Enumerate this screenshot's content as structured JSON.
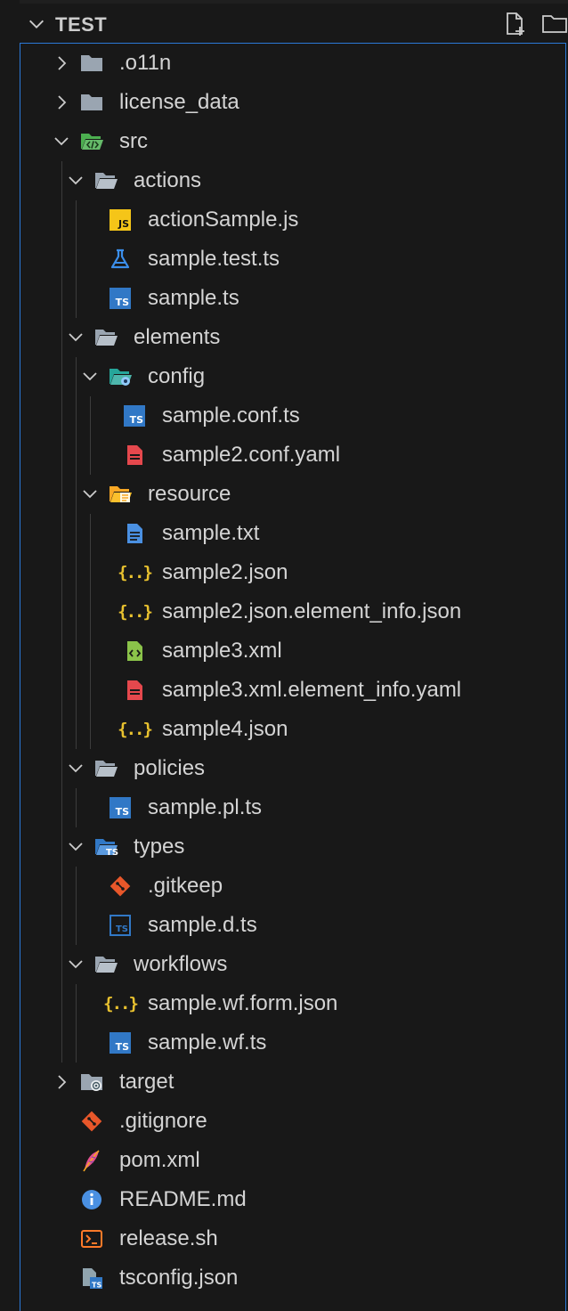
{
  "explorer": {
    "section_title": "TEST",
    "actions": [
      {
        "name": "new-file-icon"
      },
      {
        "name": "new-folder-icon"
      }
    ]
  },
  "tree": [
    {
      "label": ".o11n",
      "depth": 0,
      "kind": "folder",
      "state": "collapsed",
      "icon": "folder-icon"
    },
    {
      "label": "license_data",
      "depth": 0,
      "kind": "folder",
      "state": "collapsed",
      "icon": "folder-icon"
    },
    {
      "label": "src",
      "depth": 0,
      "kind": "folder",
      "state": "expanded",
      "icon": "folder-src-icon"
    },
    {
      "label": "actions",
      "depth": 1,
      "kind": "folder",
      "state": "expanded",
      "icon": "folder-open-icon"
    },
    {
      "label": "actionSample.js",
      "depth": 2,
      "kind": "file",
      "icon": "javascript-icon"
    },
    {
      "label": "sample.test.ts",
      "depth": 2,
      "kind": "file",
      "icon": "test-flask-icon"
    },
    {
      "label": "sample.ts",
      "depth": 2,
      "kind": "file",
      "icon": "typescript-icon"
    },
    {
      "label": "elements",
      "depth": 1,
      "kind": "folder",
      "state": "expanded",
      "icon": "folder-open-icon"
    },
    {
      "label": "config",
      "depth": 2,
      "kind": "folder",
      "state": "expanded",
      "icon": "folder-config-icon"
    },
    {
      "label": "sample.conf.ts",
      "depth": 3,
      "kind": "file",
      "icon": "typescript-icon"
    },
    {
      "label": "sample2.conf.yaml",
      "depth": 3,
      "kind": "file",
      "icon": "yaml-icon"
    },
    {
      "label": "resource",
      "depth": 2,
      "kind": "folder",
      "state": "expanded",
      "icon": "folder-resource-icon"
    },
    {
      "label": "sample.txt",
      "depth": 3,
      "kind": "file",
      "icon": "text-file-icon"
    },
    {
      "label": "sample2.json",
      "depth": 3,
      "kind": "file",
      "icon": "json-icon"
    },
    {
      "label": "sample2.json.element_info.json",
      "depth": 3,
      "kind": "file",
      "icon": "json-icon"
    },
    {
      "label": "sample3.xml",
      "depth": 3,
      "kind": "file",
      "icon": "xml-icon"
    },
    {
      "label": "sample3.xml.element_info.yaml",
      "depth": 3,
      "kind": "file",
      "icon": "yaml-icon"
    },
    {
      "label": "sample4.json",
      "depth": 3,
      "kind": "file",
      "icon": "json-icon"
    },
    {
      "label": "policies",
      "depth": 1,
      "kind": "folder",
      "state": "expanded",
      "icon": "folder-open-icon"
    },
    {
      "label": "sample.pl.ts",
      "depth": 2,
      "kind": "file",
      "icon": "typescript-icon"
    },
    {
      "label": "types",
      "depth": 1,
      "kind": "folder",
      "state": "expanded",
      "icon": "folder-types-icon"
    },
    {
      "label": ".gitkeep",
      "depth": 2,
      "kind": "file",
      "icon": "git-icon"
    },
    {
      "label": "sample.d.ts",
      "depth": 2,
      "kind": "file",
      "icon": "typescript-def-icon"
    },
    {
      "label": "workflows",
      "depth": 1,
      "kind": "folder",
      "state": "expanded",
      "icon": "folder-open-icon"
    },
    {
      "label": "sample.wf.form.json",
      "depth": 2,
      "kind": "file",
      "icon": "json-icon"
    },
    {
      "label": "sample.wf.ts",
      "depth": 2,
      "kind": "file",
      "icon": "typescript-icon"
    },
    {
      "label": "target",
      "depth": 0,
      "kind": "folder",
      "state": "collapsed",
      "icon": "folder-target-icon"
    },
    {
      "label": ".gitignore",
      "depth": 0,
      "kind": "file",
      "icon": "git-icon"
    },
    {
      "label": "pom.xml",
      "depth": 0,
      "kind": "file",
      "icon": "maven-feather-icon"
    },
    {
      "label": "README.md",
      "depth": 0,
      "kind": "file",
      "icon": "info-icon"
    },
    {
      "label": "release.sh",
      "depth": 0,
      "kind": "file",
      "icon": "shell-icon"
    },
    {
      "label": "tsconfig.json",
      "depth": 0,
      "kind": "file",
      "icon": "tsconfig-icon"
    }
  ],
  "colors": {
    "background": "#181818",
    "focus_border": "#2b79d8",
    "text": "#d4d4d4",
    "typescript": "#3178c6",
    "javascript": "#f5c518",
    "json": "#e8c12f",
    "yaml": "#e5484d",
    "git": "#e8572a",
    "xml": "#8bc34a",
    "folder": "#9aa5b1"
  }
}
